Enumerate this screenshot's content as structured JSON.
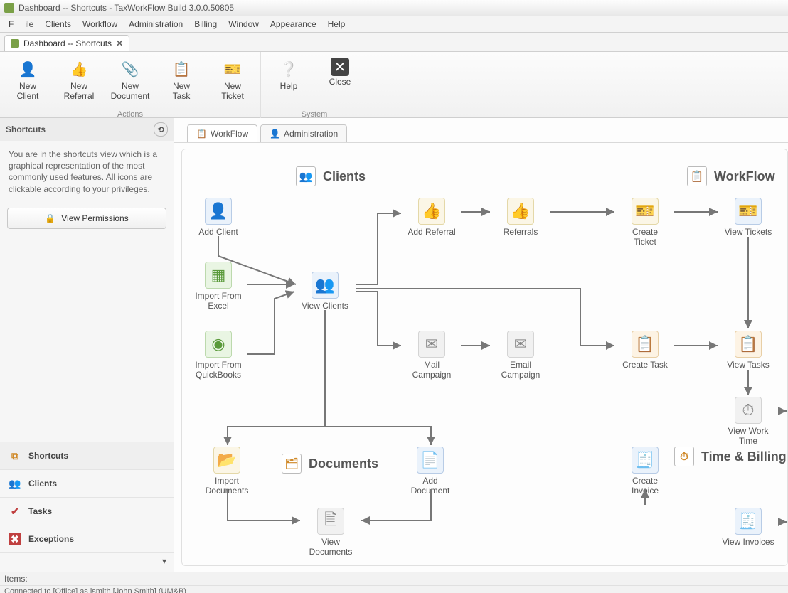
{
  "window": {
    "title": "Dashboard -- Shortcuts - TaxWorkFlow Build 3.0.0.50805"
  },
  "menu": {
    "items": [
      "File",
      "Clients",
      "Workflow",
      "Administration",
      "Billing",
      "Window",
      "Appearance",
      "Help"
    ]
  },
  "docTab": {
    "label": "Dashboard -- Shortcuts",
    "close": "✕"
  },
  "ribbon": {
    "groups": [
      {
        "caption": "Actions",
        "buttons": [
          {
            "id": "new-client",
            "label": "New\nClient",
            "icon": "👤",
            "cls": "c-blue"
          },
          {
            "id": "new-referral",
            "label": "New\nReferral",
            "icon": "👍",
            "cls": "c-orange"
          },
          {
            "id": "new-document",
            "label": "New\nDocument",
            "icon": "📎",
            "cls": "c-gray"
          },
          {
            "id": "new-task",
            "label": "New\nTask",
            "icon": "📋",
            "cls": "c-orange"
          },
          {
            "id": "new-ticket",
            "label": "New\nTicket",
            "icon": "🎫",
            "cls": "c-blue"
          }
        ]
      },
      {
        "caption": "System",
        "buttons": [
          {
            "id": "help",
            "label": "Help",
            "icon": "❔",
            "cls": "c-teal"
          },
          {
            "id": "close",
            "label": "Close",
            "icon": "✖",
            "cls": "c-gray"
          }
        ]
      }
    ]
  },
  "sidebar": {
    "title": "Shortcuts",
    "description": "You are in the shortcuts view which is a graphical representation of the most commonly used features. All icons are clickable according to your privileges.",
    "permissions_label": "View Permissions",
    "nav": [
      {
        "id": "shortcuts",
        "label": "Shortcuts",
        "icon": "🔗",
        "active": true
      },
      {
        "id": "clients",
        "label": "Clients",
        "icon": "👥",
        "active": false
      },
      {
        "id": "tasks",
        "label": "Tasks",
        "icon": "✔",
        "active": false
      },
      {
        "id": "exceptions",
        "label": "Exceptions",
        "icon": "✖",
        "active": false
      }
    ]
  },
  "mainTabs": [
    {
      "id": "workflow",
      "label": "WorkFlow",
      "icon": "📋",
      "active": true
    },
    {
      "id": "admin",
      "label": "Administration",
      "icon": "👤",
      "active": false
    }
  ],
  "sections": {
    "clients": {
      "title": "Clients"
    },
    "workflow": {
      "title": "WorkFlow"
    },
    "documents": {
      "title": "Documents"
    },
    "billing": {
      "title": "Time & Billing"
    }
  },
  "nodes": {
    "add_client": {
      "label": "Add Client"
    },
    "import_excel": {
      "label": "Import From\nExcel"
    },
    "import_qb": {
      "label": "Import From\nQuickBooks"
    },
    "view_clients": {
      "label": "View Clients"
    },
    "add_referral": {
      "label": "Add Referral"
    },
    "referrals": {
      "label": "Referrals"
    },
    "mail_campaign": {
      "label": "Mail\nCampaign"
    },
    "email_campaign": {
      "label": "Email\nCampaign"
    },
    "create_ticket": {
      "label": "Create\nTicket"
    },
    "view_tickets": {
      "label": "View Tickets"
    },
    "create_task": {
      "label": "Create Task"
    },
    "view_tasks": {
      "label": "View Tasks"
    },
    "view_worktime": {
      "label": "View Work Time"
    },
    "create_invoice": {
      "label": "Create\nInvoice"
    },
    "view_invoices": {
      "label": "View Invoices"
    },
    "import_documents": {
      "label": "Import\nDocuments"
    },
    "add_document": {
      "label": "Add\nDocument"
    },
    "view_documents": {
      "label": "View\nDocuments"
    }
  },
  "status": {
    "items": "Items:",
    "connection": "Connected to [Office] as jsmith [John Smith]  (UM&B)"
  }
}
